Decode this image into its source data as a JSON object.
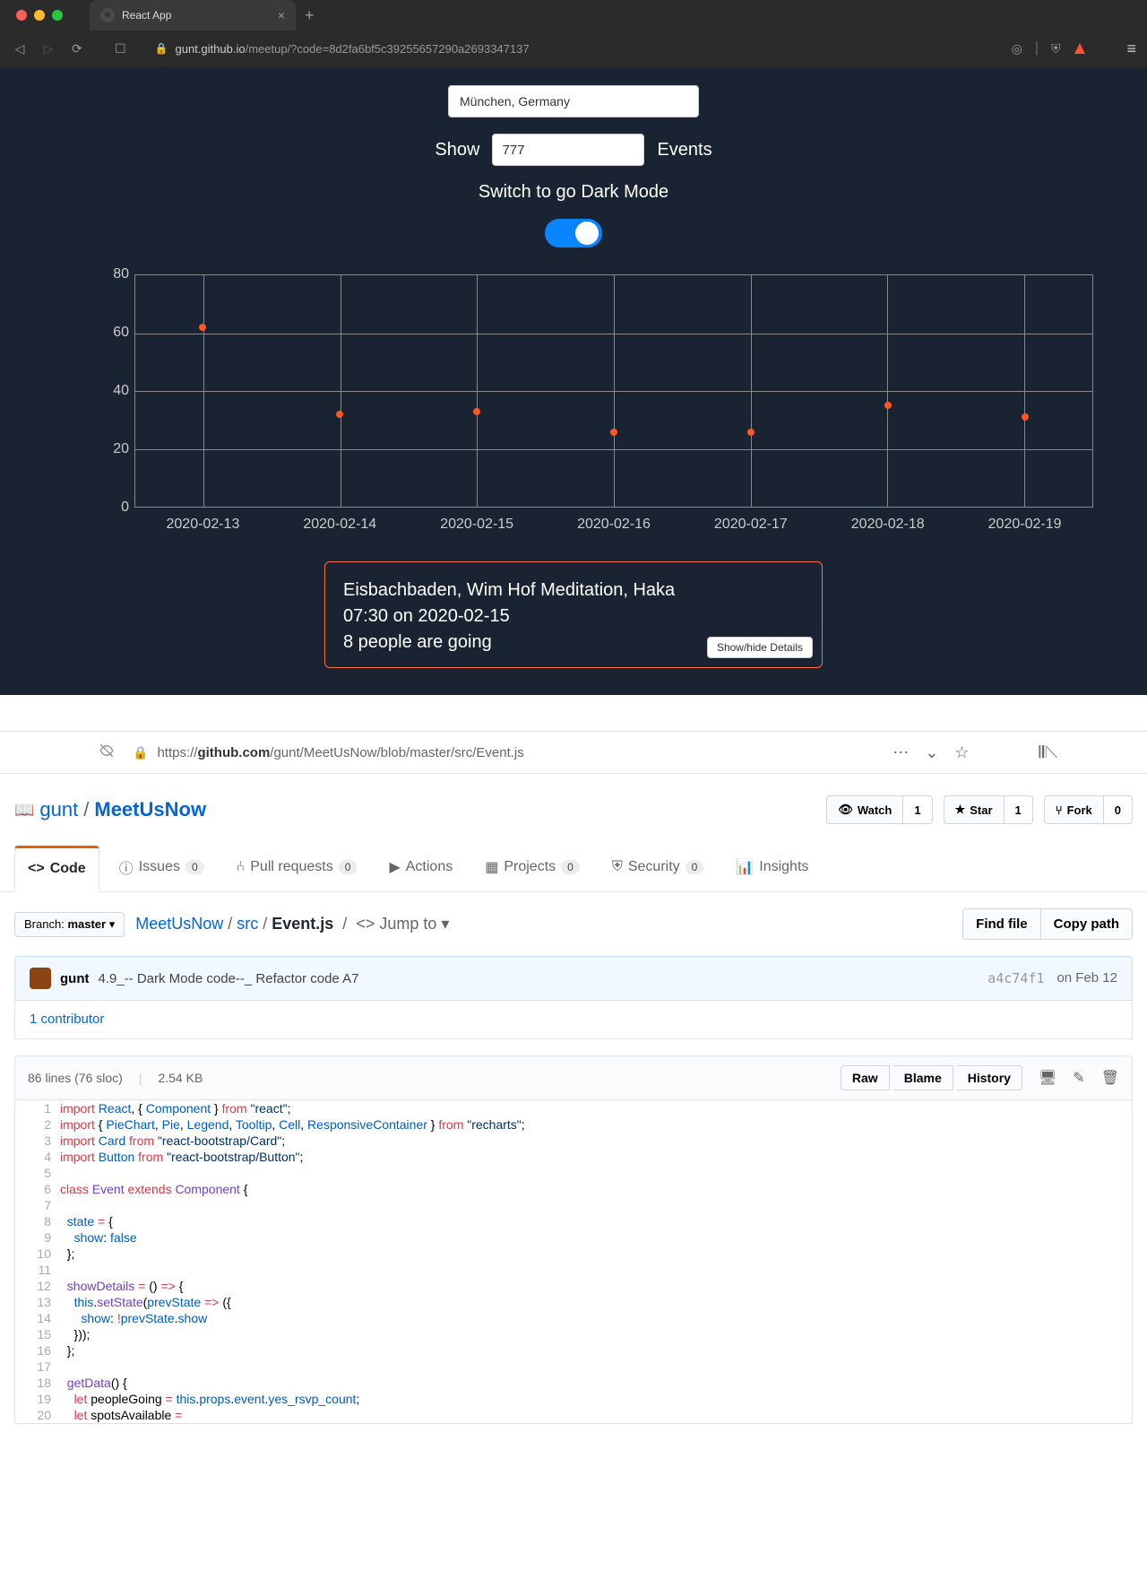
{
  "browser": {
    "tab_title": "React App",
    "url_display": {
      "domain": "gunt.github.io",
      "path": "/meetup/?code=8d2fa6bf5c39255657290a2693347137"
    }
  },
  "app": {
    "location_value": "München, Germany",
    "show_label_left": "Show",
    "show_value": "777",
    "show_label_right": "Events",
    "toggle_label": "Switch to go Dark Mode",
    "event": {
      "title": "Eisbachbaden, Wim Hof Meditation, Haka",
      "time": "07:30 on 2020-02-15",
      "people": "8 people are going",
      "details_btn": "Show/hide Details"
    }
  },
  "chart_data": {
    "type": "scatter",
    "title": "",
    "xlabel": "",
    "ylabel": "",
    "ylim": [
      0,
      80
    ],
    "y_ticks": [
      0,
      20,
      40,
      60,
      80
    ],
    "x_ticks": [
      "2020-02-13",
      "2020-02-14",
      "2020-02-15",
      "2020-02-16",
      "2020-02-17",
      "2020-02-18",
      "2020-02-19"
    ],
    "values": [
      62,
      32,
      33,
      26,
      26,
      35,
      31
    ]
  },
  "github": {
    "url": {
      "prefix": "https://",
      "domain": "github.com",
      "path": "/gunt/MeetUsNow/blob/master/src/Event.js"
    },
    "owner": "gunt",
    "repo": "MeetUsNow",
    "watch": {
      "label": "Watch",
      "count": "1"
    },
    "star": {
      "label": "Star",
      "count": "1"
    },
    "fork": {
      "label": "Fork",
      "count": "0"
    },
    "tabs": {
      "code": "Code",
      "issues": "Issues",
      "issues_count": "0",
      "prs": "Pull requests",
      "prs_count": "0",
      "actions": "Actions",
      "projects": "Projects",
      "projects_count": "0",
      "security": "Security",
      "security_count": "0",
      "insights": "Insights"
    },
    "branch_label": "Branch:",
    "branch": "master",
    "path": {
      "root": "MeetUsNow",
      "src": "src",
      "file": "Event.js",
      "jump": "Jump to"
    },
    "find_file": "Find file",
    "copy_path": "Copy path",
    "commit": {
      "author": "gunt",
      "msg": "4.9_-- Dark Mode code--_ Refactor code A7",
      "sha": "a4c74f1",
      "date": "on Feb 12"
    },
    "contributors": "1 contributor",
    "file_stats": {
      "lines": "86 lines (76 sloc)",
      "size": "2.54 KB"
    },
    "file_btns": {
      "raw": "Raw",
      "blame": "Blame",
      "history": "History"
    }
  }
}
